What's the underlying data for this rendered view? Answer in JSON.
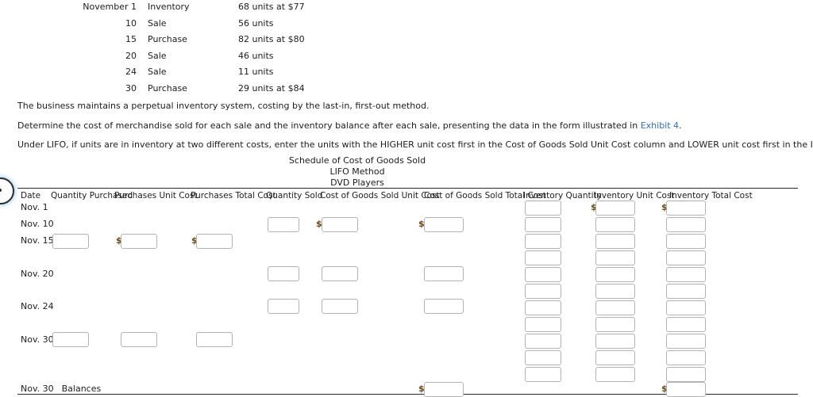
{
  "transactions": {
    "rows": [
      {
        "date": "November 1",
        "type": "Inventory",
        "desc": "68 units at $77"
      },
      {
        "date": "10",
        "type": "Sale",
        "desc": "56 units"
      },
      {
        "date": "15",
        "type": "Purchase",
        "desc": "82 units at $80"
      },
      {
        "date": "20",
        "type": "Sale",
        "desc": "46 units"
      },
      {
        "date": "24",
        "type": "Sale",
        "desc": "11 units"
      },
      {
        "date": "30",
        "type": "Purchase",
        "desc": "29 units at $84"
      }
    ]
  },
  "instructions": {
    "line1": "The business maintains a perpetual inventory system, costing by the last-in, first-out method.",
    "line2_before": "Determine the cost of merchandise sold for each sale and the inventory balance after each sale, presenting the data in the form illustrated in ",
    "line2_link": "Exhibit 4",
    "line2_after": ".",
    "line3": "Under LIFO, if units are in inventory at two different costs, enter the units with the HIGHER unit cost first in the Cost of Goods Sold Unit Cost column and LOWER unit cost first in the Inventory Unit Cost column.",
    "link_color": "#2f6fba"
  },
  "schedule": {
    "title_line1": "Schedule of Cost of Goods Sold",
    "title_line2": "LIFO Method",
    "title_line3": "DVD Players"
  },
  "table": {
    "headers": [
      "Date",
      "Quantity Purchased",
      "Purchases Unit Cost",
      "Purchases Total Cost",
      "Quantity Sold",
      "Cost of Goods Sold Unit Cost",
      "Cost of Goods Sold Total Cost",
      "Inventory Quantity",
      "Inventory Unit Cost",
      "Inventory Total Cost"
    ],
    "row_labels": [
      "Nov. 1",
      "Nov. 10",
      "Nov. 15",
      "Nov. 20",
      "Nov. 24",
      "Nov. 30"
    ],
    "footer_label_date": "Nov. 30",
    "footer_label_text": "Balances",
    "currency_symbol": "$",
    "input_value": ""
  }
}
